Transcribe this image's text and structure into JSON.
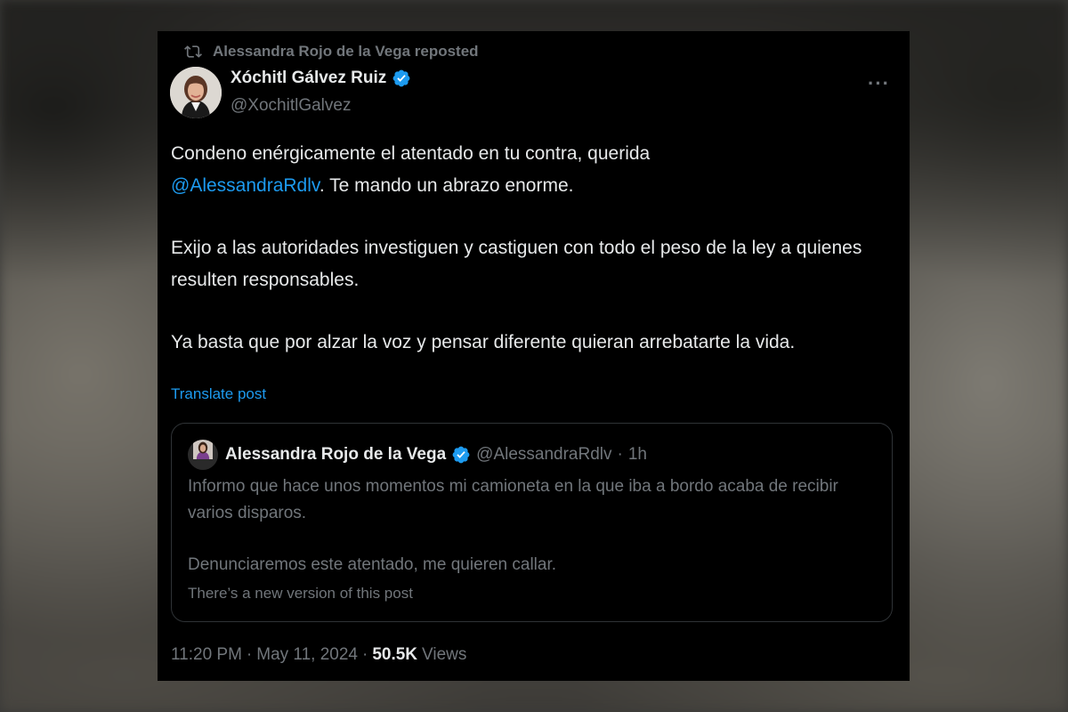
{
  "repost": {
    "text": "Alessandra Rojo de la Vega reposted",
    "icon": "repost-icon"
  },
  "author": {
    "name": "Xóchitl Gálvez Ruiz",
    "handle": "@XochitlGalvez",
    "verified": true
  },
  "more_menu": {
    "label": "···",
    "icon": "more-icon"
  },
  "post": {
    "line1_text": "Condeno enérgicamente el atentado en tu contra, querida",
    "mention": "@AlessandraRdlv",
    "line2_text": ". Te mando un abrazo enorme.",
    "paragraph2": "Exijo a las autoridades investiguen y castiguen con todo el peso de la ley a quienes resulten responsables.",
    "paragraph3": "Ya basta que por alzar la voz y pensar diferente quieran arrebatarte la vida."
  },
  "translate_label": "Translate post",
  "quote": {
    "name": "Alessandra Rojo de la Vega",
    "handle": "@AlessandraRdlv",
    "separator": "·",
    "time": "1h",
    "paragraph1": "Informo que hace unos momentos mi camioneta en la que iba a bordo acaba de recibir varios disparos.",
    "paragraph2": "Denunciaremos este atentado, me quieren callar.",
    "note": "There’s a new version of this post"
  },
  "meta": {
    "time": "11:20 PM",
    "separator": "·",
    "date": "May 11, 2024",
    "views_count": "50.5K",
    "views_label": "Views"
  },
  "colors": {
    "background": "#000000",
    "text": "#e7e9ea",
    "muted": "#71767b",
    "link": "#1d9bf0",
    "border": "#2f3336"
  }
}
